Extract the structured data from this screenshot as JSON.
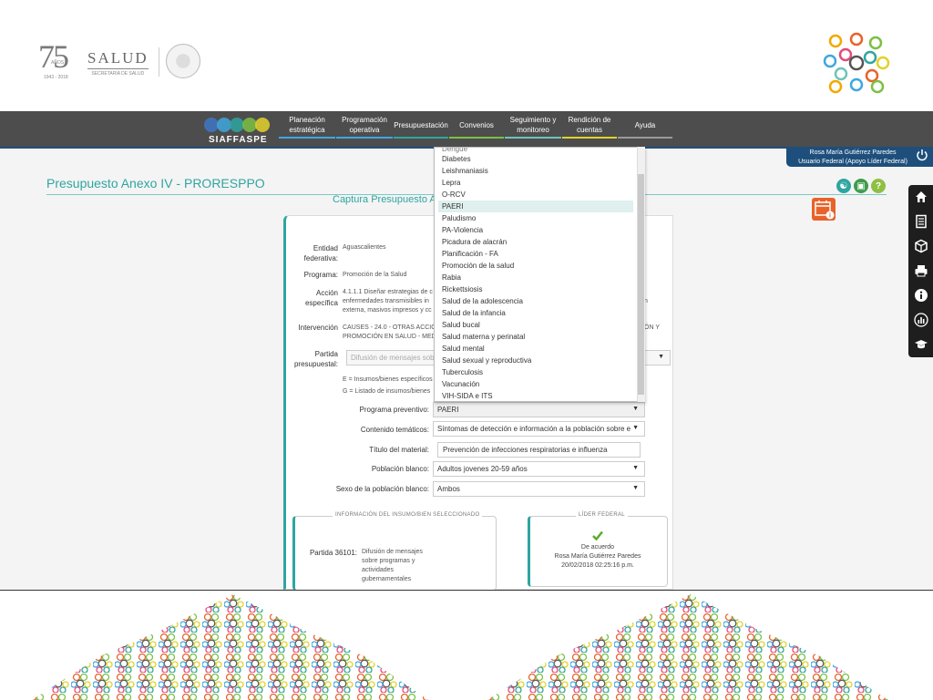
{
  "header": {
    "logo_75": {
      "number": "75",
      "tag": "AÑOS",
      "years": "1943 - 2018"
    },
    "logo_salud": {
      "name": "SALUD",
      "subtitle": "SECRETARÍA DE SALUD"
    }
  },
  "nav": {
    "brand": "SIAFFASPE",
    "items": [
      {
        "label": "Planeación estratégica",
        "color": "#3fa7e1"
      },
      {
        "label": "Programación operativa",
        "color": "#3fa7e1"
      },
      {
        "label": "Presupuestación",
        "color": "#2fa5a0"
      },
      {
        "label": "Convenios",
        "color": "#7bc043"
      },
      {
        "label": "Seguimiento y monitoreo",
        "color": "#6fc4b8"
      },
      {
        "label": "Rendición de cuentas",
        "color": "#e3d22b"
      },
      {
        "label": "Ayuda",
        "color": "#9a9a9a"
      }
    ]
  },
  "user": {
    "name": "Rosa María Gutiérrez Paredes",
    "role": "Usuario Federal (Apoyo Líder Federal)"
  },
  "page": {
    "title": "Presupuesto Anexo IV - PRORESPPO",
    "subtitle": "Captura Presupuesto A"
  },
  "form": {
    "entidad_label": "Entidad federativa:",
    "entidad_value": "Aguascalientes",
    "programa_label": "Programa:",
    "programa_value": "Promoción de la Salud",
    "accion_label": "Acción específica",
    "accion_value_l1": "4.1.1.1 Diseñar estrategias de c",
    "accion_value_l2": "enfermedades transmisibles in",
    "accion_value_l3": "externa, masivos impresos y cc",
    "accion_right": "n",
    "intervencion_label": "Intervención",
    "intervencion_value_l1": "CAUSES - 24.0 - OTRAS ACCION",
    "intervencion_value_l2": "PROMOCIÓN EN SALUD - MED",
    "intervencion_right": "ÓN Y",
    "partida_label": "Partida presupuestal:",
    "partida_value": "Difusión de mensajes sobr",
    "note_e": "E = Insumos/bienes específicos",
    "note_g": "G = Listado de insumos/bienes",
    "programa_preventivo_label": "Programa preventivo:",
    "programa_preventivo_value": "PAERI",
    "contenido_label": "Contenido temáticos:",
    "contenido_value": "Síntomas de detección e información a la población sobre e",
    "titulo_label": "Título del material:",
    "titulo_value": "Prevención de infecciones respiratorias e influenza",
    "poblacion_label": "Población blanco:",
    "poblacion_value": "Adultos jovenes 20-59 años",
    "sexo_label": "Sexo de la población blanco:",
    "sexo_value": "Ambos"
  },
  "info_card": {
    "legend": "INFORMACIÓN DEL INSUMO/BIEN SELECCIONADO",
    "partida_label": "Partida 36101:",
    "desc_l1": "Difusión de mensajes",
    "desc_l2": "sobre programas y",
    "desc_l3": "actividades",
    "desc_l4": "gubernamentales"
  },
  "lider_card": {
    "legend": "LÍDER FEDERAL",
    "status": "De acuerdo",
    "name": "Rosa María Gutiérrez Paredes",
    "date": "20/02/2018 02:25:16 p.m."
  },
  "dropdown": {
    "partial_top": "Dengue",
    "selected": "PAERI",
    "options": [
      "Diabetes",
      "Leishmaniasis",
      "Lepra",
      "O-RCV",
      "PAERI",
      "Paludismo",
      "PA-Violencia",
      "Picadura de alacrán",
      "Planificación - FA",
      "Promoción de la salud",
      "Rabia",
      "Rickettsiosis",
      "Salud de la adolescencia",
      "Salud de la infancia",
      "Salud bucal",
      "Salud materna y perinatal",
      "Salud mental",
      "Salud sexual y reproductiva",
      "Tuberculosis",
      "Vacunación",
      "VIH-SIDA e ITS"
    ]
  },
  "colors": {
    "teal": "#2fa5a0",
    "navbar": "#4d4d4d",
    "navy": "#1e4f7c",
    "calendar": "#e8632a"
  },
  "icons": {
    "side": [
      "home-icon",
      "document-list-icon",
      "cube-icon",
      "printer-icon",
      "info-icon",
      "chart-icon",
      "graduation-cap-icon"
    ],
    "top_right": [
      "users-icon",
      "lock-icon",
      "help-icon"
    ]
  }
}
